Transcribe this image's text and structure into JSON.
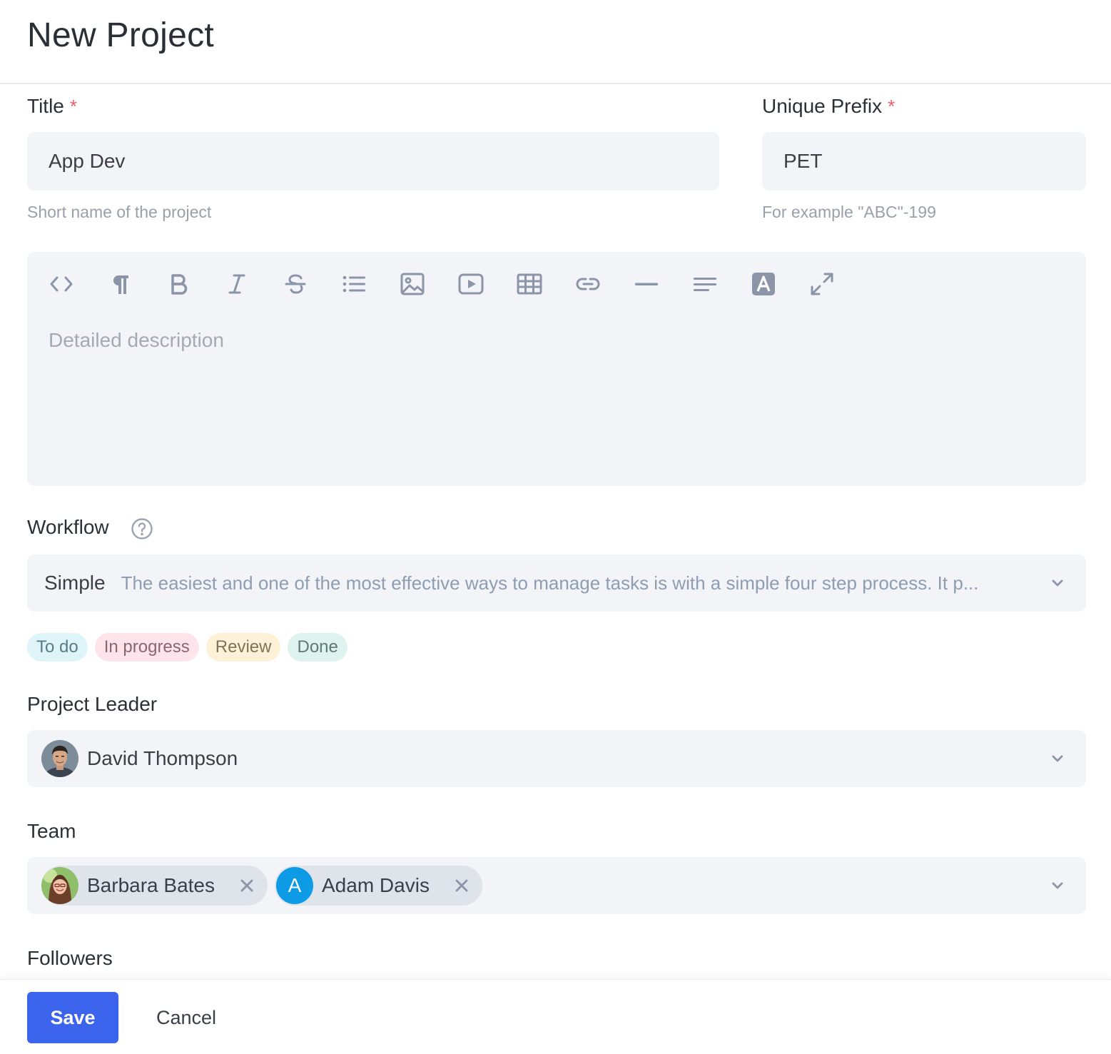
{
  "page": {
    "title": "New Project"
  },
  "title_field": {
    "label": "Title",
    "required_mark": "*",
    "value": "App Dev",
    "hint": "Short name of the project"
  },
  "prefix_field": {
    "label": "Unique Prefix",
    "required_mark": "*",
    "value": "PET",
    "hint": "For example \"ABC\"-199"
  },
  "editor": {
    "placeholder": "Detailed description",
    "toolbar": [
      "code-view-icon",
      "paragraph-icon",
      "bold-icon",
      "italic-icon",
      "strikethrough-icon",
      "bullet-list-icon",
      "image-icon",
      "video-icon",
      "table-icon",
      "link-icon",
      "horizontal-rule-icon",
      "align-icon",
      "font-color-icon",
      "fullscreen-icon"
    ]
  },
  "workflow": {
    "label": "Workflow",
    "selected_name": "Simple",
    "selected_description": "The easiest and one of the most effective ways to manage tasks is with a simple four step process. It p...",
    "stages": [
      {
        "label": "To do",
        "bg": "#dff4f9",
        "fg": "#5b7c86"
      },
      {
        "label": "In progress",
        "bg": "#fce4ea",
        "fg": "#8a6770"
      },
      {
        "label": "Review",
        "bg": "#fdf2d8",
        "fg": "#7f7257"
      },
      {
        "label": "Done",
        "bg": "#def2ee",
        "fg": "#5f7a74"
      }
    ]
  },
  "project_leader": {
    "label": "Project Leader",
    "name": "David Thompson"
  },
  "team": {
    "label": "Team",
    "members": [
      {
        "name": "Barbara Bates"
      },
      {
        "name": "Adam Davis",
        "initial": "A"
      }
    ]
  },
  "followers": {
    "label": "Followers"
  },
  "footer": {
    "save_label": "Save",
    "cancel_label": "Cancel"
  },
  "colors": {
    "primary": "#3b63ec",
    "required": "#ef5b6d",
    "field_bg": "#f2f4f8",
    "avatar_blue": "#0e9be6"
  }
}
